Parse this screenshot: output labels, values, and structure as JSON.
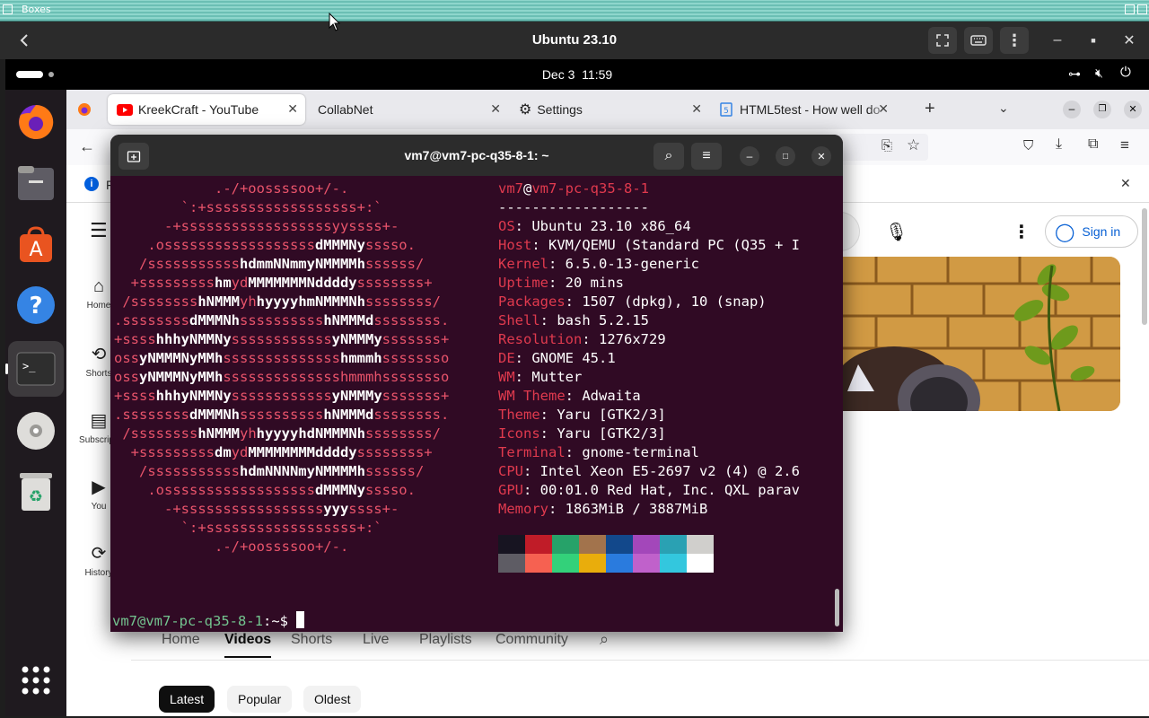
{
  "boxes": {
    "title": "Boxes"
  },
  "vm_header": {
    "title": "Ubuntu 23.10"
  },
  "top_panel": {
    "date": "Dec 3",
    "time": "11:59"
  },
  "dock": {
    "items": [
      "firefox-icon",
      "files-icon",
      "app-center-icon",
      "help-icon",
      "terminal-icon",
      "disc-icon",
      "trash-icon",
      "show-apps-icon"
    ]
  },
  "browser": {
    "tabs": [
      {
        "label": "KreekCraft - YouTube",
        "icon": "youtube-icon",
        "active": true
      },
      {
        "label": "CollabNet",
        "icon": "",
        "active": false
      },
      {
        "label": "Settings",
        "icon": "gear-icon",
        "active": false
      },
      {
        "label": "HTML5test - How well do",
        "icon": "html5-icon",
        "active": false
      }
    ],
    "notice_letter": "F"
  },
  "youtube": {
    "sidebar": [
      {
        "label": "Home",
        "icon": "home-icon"
      },
      {
        "label": "Shorts",
        "icon": "shorts-icon"
      },
      {
        "label": "Subscripti",
        "icon": "subscriptions-icon"
      },
      {
        "label": "You",
        "icon": "you-icon"
      },
      {
        "label": "History",
        "icon": "history-icon"
      }
    ],
    "sign_in": "Sign in",
    "channel_tabs": [
      "Home",
      "Videos",
      "Shorts",
      "Live",
      "Playlists",
      "Community"
    ],
    "selected_tab": "Videos",
    "filters": [
      "Latest",
      "Popular",
      "Oldest"
    ],
    "selected_filter": "Latest"
  },
  "terminal": {
    "title": "vm7@vm7-pc-q35-8-1: ~",
    "user": "vm7",
    "host": "vm7-pc-q35-8-1",
    "separator": "------------------",
    "info": [
      {
        "key": "OS",
        "value": "Ubuntu 23.10 x86_64"
      },
      {
        "key": "Host",
        "value": "KVM/QEMU (Standard PC (Q35 + I"
      },
      {
        "key": "Kernel",
        "value": "6.5.0-13-generic"
      },
      {
        "key": "Uptime",
        "value": "20 mins"
      },
      {
        "key": "Packages",
        "value": "1507 (dpkg), 10 (snap)"
      },
      {
        "key": "Shell",
        "value": "bash 5.2.15"
      },
      {
        "key": "Resolution",
        "value": "1276x729"
      },
      {
        "key": "DE",
        "value": "GNOME 45.1"
      },
      {
        "key": "WM",
        "value": "Mutter"
      },
      {
        "key": "WM Theme",
        "value": "Adwaita"
      },
      {
        "key": "Theme",
        "value": "Yaru [GTK2/3]"
      },
      {
        "key": "Icons",
        "value": "Yaru [GTK2/3]"
      },
      {
        "key": "Terminal",
        "value": "gnome-terminal"
      },
      {
        "key": "CPU",
        "value": "Intel Xeon E5-2697 v2 (4) @ 2.6"
      },
      {
        "key": "GPU",
        "value": "00:01.0 Red Hat, Inc. QXL parav"
      },
      {
        "key": "Memory",
        "value": "1863MiB / 3887MiB"
      }
    ],
    "palette_top": [
      "#171421",
      "#c01c28",
      "#26a269",
      "#a2734c",
      "#12488b",
      "#a347ba",
      "#2aa1b3",
      "#d0cfcc"
    ],
    "palette_bottom": [
      "#5e5c64",
      "#f66151",
      "#33d17a",
      "#e9ad0c",
      "#2a7bde",
      "#c061cb",
      "#33c7de",
      "#ffffff"
    ],
    "prompt_user_host": "vm7@vm7-pc-q35-8-1",
    "prompt_rest": ":~$ "
  }
}
